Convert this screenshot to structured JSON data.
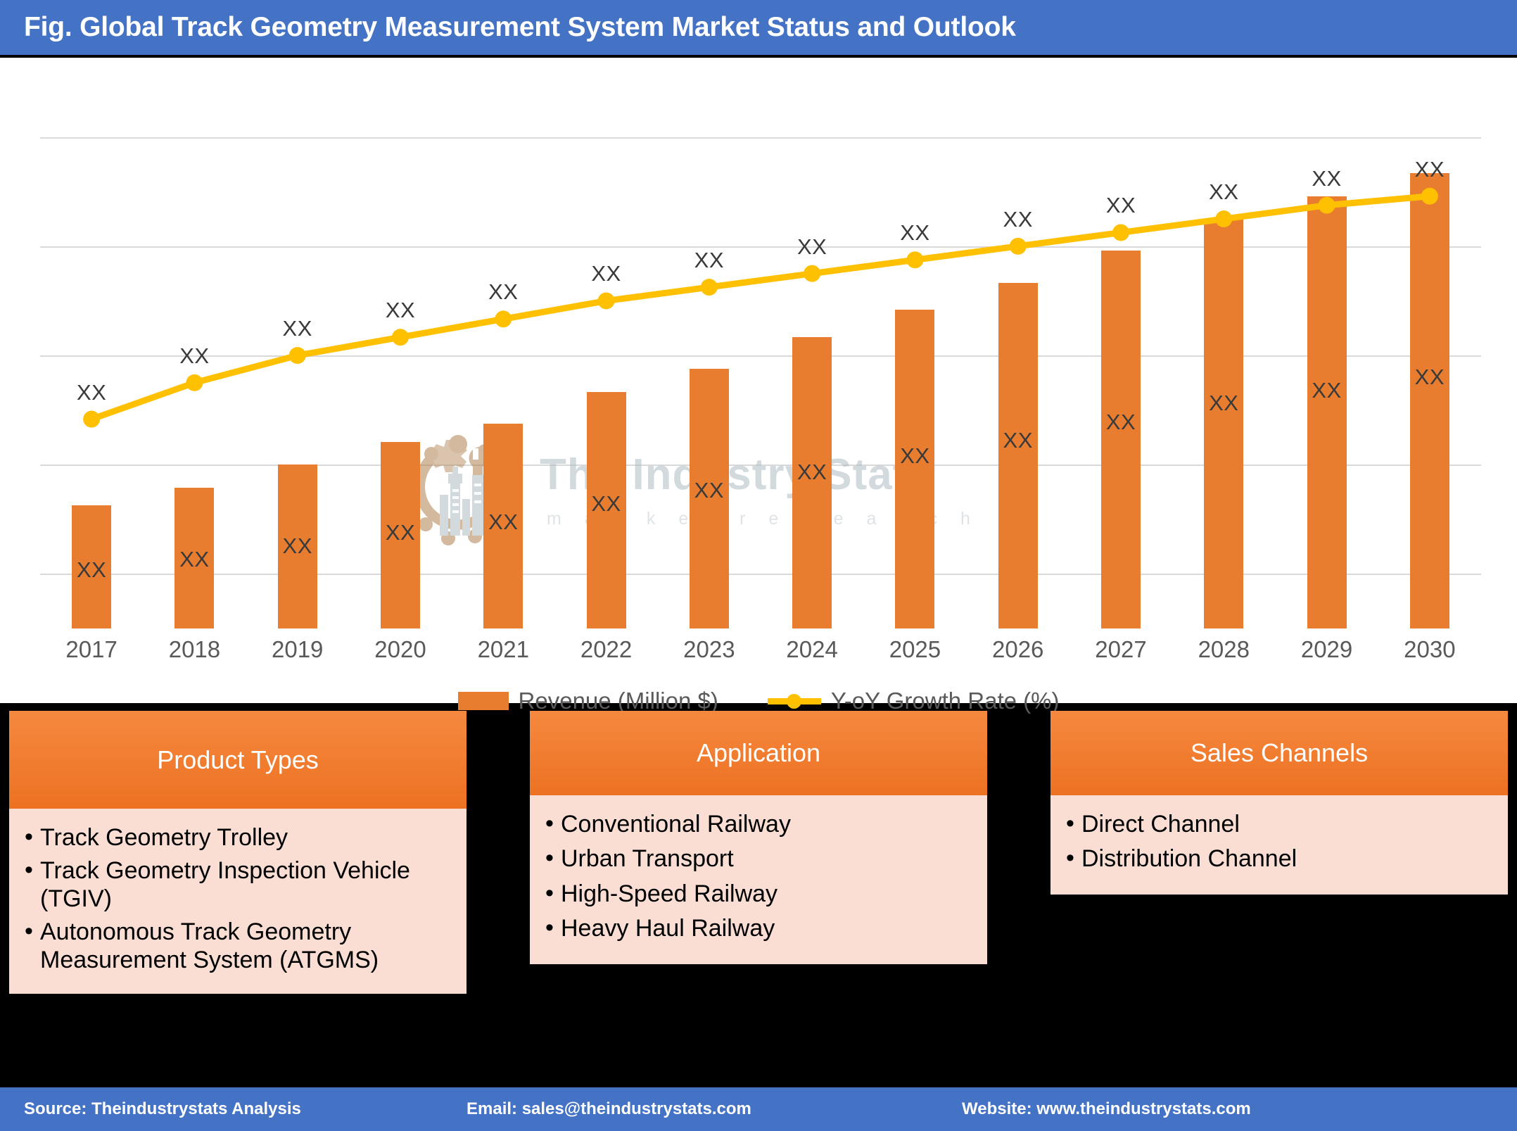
{
  "header": {
    "title": "Fig. Global Track Geometry Measurement System Market Status and Outlook",
    "background": "#4472C4"
  },
  "chart_data": {
    "type": "bar",
    "title": "Fig. Global Track Geometry Measurement System Market Status and Outlook",
    "xlabel": "",
    "ylabel": "",
    "grid": true,
    "legend_position": "bottom",
    "categories": [
      "2017",
      "2018",
      "2019",
      "2020",
      "2021",
      "2022",
      "2023",
      "2024",
      "2025",
      "2026",
      "2027",
      "2028",
      "2029",
      "2030"
    ],
    "series": [
      {
        "name": "Revenue (Million $)",
        "type": "bar",
        "color": "#E87D2F",
        "values": [
          27,
          31,
          36,
          41,
          45,
          52,
          57,
          64,
          70,
          76,
          83,
          90,
          95,
          100
        ],
        "data_labels": [
          "XX",
          "XX",
          "XX",
          "XX",
          "XX",
          "XX",
          "XX",
          "XX",
          "XX",
          "XX",
          "XX",
          "XX",
          "XX",
          "XX"
        ]
      },
      {
        "name": "Y-oY Growth Rate (%)",
        "type": "line",
        "color": "#FFC000",
        "values": [
          46,
          54,
          60,
          64,
          68,
          72,
          75,
          78,
          81,
          84,
          87,
          90,
          93,
          95
        ],
        "data_labels": [
          "XX",
          "XX",
          "XX",
          "XX",
          "XX",
          "XX",
          "XX",
          "XX",
          "XX",
          "XX",
          "XX",
          "XX",
          "XX",
          "XX"
        ]
      }
    ],
    "ylim": [
      0,
      118
    ],
    "gridline_values": [
      12,
      36,
      60,
      84,
      108
    ],
    "watermark": {
      "text": "The Industry Stats",
      "subtext": "m a r k e t    r e s e a r c h"
    }
  },
  "legend": {
    "items": [
      {
        "label": "Revenue (Million $)",
        "color": "#E87D2F",
        "marker": "bar-swatch"
      },
      {
        "label": "Y-oY Growth Rate (%)",
        "color": "#FFC000",
        "marker": "line-swatch"
      }
    ]
  },
  "cards": [
    {
      "title": "Product Types",
      "items": [
        "Track Geometry Trolley",
        "Track Geometry Inspection Vehicle (TGIV)",
        "Autonomous Track Geometry Measurement System (ATGMS)"
      ]
    },
    {
      "title": "Application",
      "items": [
        "Conventional Railway",
        "Urban Transport",
        "High-Speed Railway",
        "Heavy Haul Railway"
      ]
    },
    {
      "title": "Sales Channels",
      "items": [
        "Direct Channel",
        "Distribution Channel"
      ]
    }
  ],
  "footer": {
    "source": "Source: Theindustrystats Analysis",
    "email": "Email: sales@theindustrystats.com",
    "website": "Website: www.theindustrystats.com",
    "background": "#4472C4"
  }
}
